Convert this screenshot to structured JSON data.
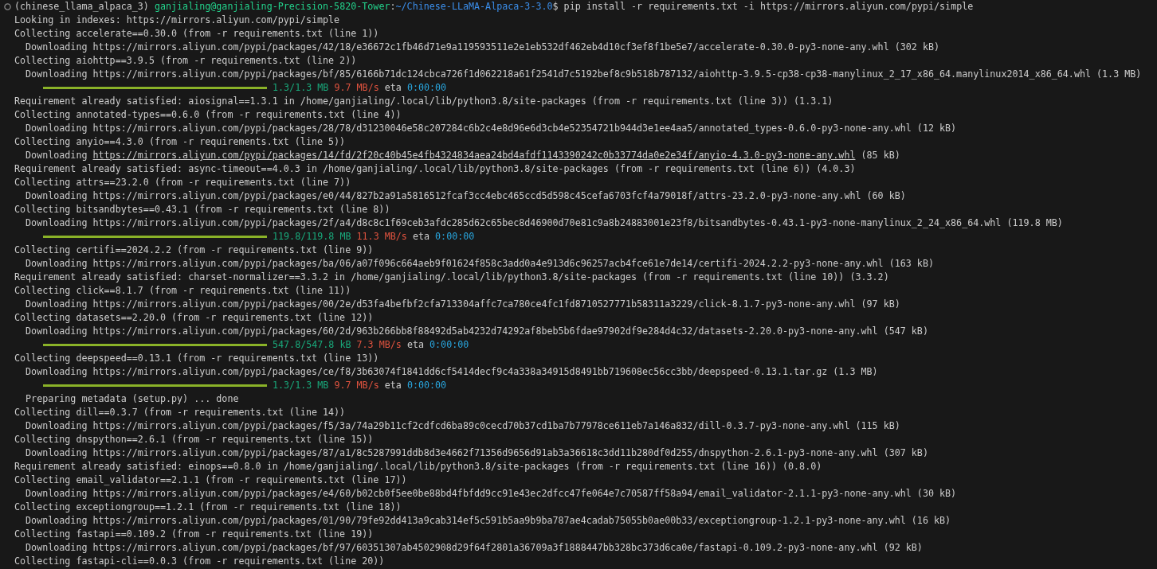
{
  "terminal": {
    "lines": [
      {
        "kind": "prompt",
        "env": "(chinese_llama_alpaca_3)",
        "user_host": "ganjialing@ganjialing-Precision-5820-Tower",
        "separator": ":",
        "path": "~/Chinese-LLaMA-Alpaca-3-3.0",
        "command": "$ pip install -r requirements.txt -i https://mirrors.aliyun.com/pypi/simple"
      },
      {
        "kind": "plain",
        "text": "Looking in indexes: https://mirrors.aliyun.com/pypi/simple"
      },
      {
        "kind": "plain",
        "text": "Collecting accelerate==0.30.0 (from -r requirements.txt (line 1))"
      },
      {
        "kind": "indented",
        "text": "Downloading https://mirrors.aliyun.com/pypi/packages/42/18/e36672c1fb46d71e9a119593511e2e1eb532df462eb4d10cf3ef8f1be5e7/accelerate-0.30.0-py3-none-any.whl (302 kB)"
      },
      {
        "kind": "plain",
        "text": "Collecting aiohttp==3.9.5 (from -r requirements.txt (line 2))"
      },
      {
        "kind": "indented",
        "text": "Downloading https://mirrors.aliyun.com/pypi/packages/bf/85/6166b71dc124cbca726f1d062218a61f2541d7c5192bef8c9b518b787132/aiohttp-3.9.5-cp38-cp38-manylinux_2_17_x86_64.manylinux2014_x86_64.whl (1.3 MB)"
      },
      {
        "kind": "progress",
        "level": 1,
        "size": "1.3/1.3 MB",
        "speed": "9.7 MB/s",
        "eta_label": "eta",
        "eta": "0:00:00"
      },
      {
        "kind": "plain",
        "text": "Requirement already satisfied: aiosignal==1.3.1 in /home/ganjialing/.local/lib/python3.8/site-packages (from -r requirements.txt (line 3)) (1.3.1)"
      },
      {
        "kind": "plain",
        "text": "Collecting annotated-types==0.6.0 (from -r requirements.txt (line 4))"
      },
      {
        "kind": "indented",
        "text": "Downloading https://mirrors.aliyun.com/pypi/packages/28/78/d31230046e58c207284c6b2c4e8d96e6d3cb4e52354721b944d3e1ee4aa5/annotated_types-0.6.0-py3-none-any.whl (12 kB)"
      },
      {
        "kind": "plain",
        "text": "Collecting anyio==4.3.0 (from -r requirements.txt (line 5))"
      },
      {
        "kind": "link",
        "prefix": "Downloading",
        "url": "https://mirrors.aliyun.com/pypi/packages/14/fd/2f20c40b45e4fb4324834aea24bd4afdf1143390242c0b33774da0e2e34f/anyio-4.3.0-py3-none-any.whl",
        "suffix": "(85 kB)"
      },
      {
        "kind": "plain",
        "text": "Requirement already satisfied: async-timeout==4.0.3 in /home/ganjialing/.local/lib/python3.8/site-packages (from -r requirements.txt (line 6)) (4.0.3)"
      },
      {
        "kind": "plain",
        "text": "Collecting attrs==23.2.0 (from -r requirements.txt (line 7))"
      },
      {
        "kind": "indented",
        "text": "Downloading https://mirrors.aliyun.com/pypi/packages/e0/44/827b2a91a5816512fcaf3cc4ebc465ccd5d598c45cefa6703fcf4a79018f/attrs-23.2.0-py3-none-any.whl (60 kB)"
      },
      {
        "kind": "plain",
        "text": "Collecting bitsandbytes==0.43.1 (from -r requirements.txt (line 8))"
      },
      {
        "kind": "indented",
        "text": "Downloading https://mirrors.aliyun.com/pypi/packages/2f/a4/d8c8c1f69ceb3afdc285d62c65bec8d46900d70e81c9a8b24883001e23f8/bitsandbytes-0.43.1-py3-none-manylinux_2_24_x86_64.whl (119.8 MB)"
      },
      {
        "kind": "progress",
        "level": 1,
        "size": "119.8/119.8 MB",
        "speed": "11.3 MB/s",
        "eta_label": "eta",
        "eta": "0:00:00"
      },
      {
        "kind": "plain",
        "text": "Collecting certifi==2024.2.2 (from -r requirements.txt (line 9))"
      },
      {
        "kind": "indented",
        "text": "Downloading https://mirrors.aliyun.com/pypi/packages/ba/06/a07f096c664aeb9f01624f858c3add0a4e913d6c96257acb4fce61e7de14/certifi-2024.2.2-py3-none-any.whl (163 kB)"
      },
      {
        "kind": "plain",
        "text": "Requirement already satisfied: charset-normalizer==3.3.2 in /home/ganjialing/.local/lib/python3.8/site-packages (from -r requirements.txt (line 10)) (3.3.2)"
      },
      {
        "kind": "plain",
        "text": "Collecting click==8.1.7 (from -r requirements.txt (line 11))"
      },
      {
        "kind": "indented",
        "text": "Downloading https://mirrors.aliyun.com/pypi/packages/00/2e/d53fa4befbf2cfa713304affc7ca780ce4fc1fd8710527771b58311a3229/click-8.1.7-py3-none-any.whl (97 kB)"
      },
      {
        "kind": "plain",
        "text": "Collecting datasets==2.20.0 (from -r requirements.txt (line 12))"
      },
      {
        "kind": "indented",
        "text": "Downloading https://mirrors.aliyun.com/pypi/packages/60/2d/963b266bb8f88492d5ab4232d74292af8beb5b6fdae97902df9e284d4c32/datasets-2.20.0-py3-none-any.whl (547 kB)"
      },
      {
        "kind": "progress",
        "level": 1,
        "size": "547.8/547.8 kB",
        "speed": "7.3 MB/s",
        "eta_label": "eta",
        "eta": "0:00:00"
      },
      {
        "kind": "plain",
        "text": "Collecting deepspeed==0.13.1 (from -r requirements.txt (line 13))"
      },
      {
        "kind": "indented",
        "text": "Downloading https://mirrors.aliyun.com/pypi/packages/ce/f8/3b63074f1841dd6cf5414decf9c4a338a34915d8491bb719608ec56cc3bb/deepspeed-0.13.1.tar.gz (1.3 MB)"
      },
      {
        "kind": "progress",
        "level": 1,
        "size": "1.3/1.3 MB",
        "speed": "9.7 MB/s",
        "eta_label": "eta",
        "eta": "0:00:00"
      },
      {
        "kind": "indented",
        "text": "Preparing metadata (setup.py) ... done"
      },
      {
        "kind": "plain",
        "text": "Collecting dill==0.3.7 (from -r requirements.txt (line 14))"
      },
      {
        "kind": "indented",
        "text": "Downloading https://mirrors.aliyun.com/pypi/packages/f5/3a/74a29b11cf2cdfcd6ba89c0cecd70b37cd1ba7b77978ce611eb7a146a832/dill-0.3.7-py3-none-any.whl (115 kB)"
      },
      {
        "kind": "plain",
        "text": "Collecting dnspython==2.6.1 (from -r requirements.txt (line 15))"
      },
      {
        "kind": "indented",
        "text": "Downloading https://mirrors.aliyun.com/pypi/packages/87/a1/8c5287991ddb8d3e4662f71356d9656d91ab3a36618c3dd11b280df0d255/dnspython-2.6.1-py3-none-any.whl (307 kB)"
      },
      {
        "kind": "plain",
        "text": "Requirement already satisfied: einops==0.8.0 in /home/ganjialing/.local/lib/python3.8/site-packages (from -r requirements.txt (line 16)) (0.8.0)"
      },
      {
        "kind": "plain",
        "text": "Collecting email_validator==2.1.1 (from -r requirements.txt (line 17))"
      },
      {
        "kind": "indented",
        "text": "Downloading https://mirrors.aliyun.com/pypi/packages/e4/60/b02cb0f5ee0be88bd4fbfdd9cc91e43ec2dfcc47fe064e7c70587ff58a94/email_validator-2.1.1-py3-none-any.whl (30 kB)"
      },
      {
        "kind": "plain",
        "text": "Collecting exceptiongroup==1.2.1 (from -r requirements.txt (line 18))"
      },
      {
        "kind": "indented",
        "text": "Downloading https://mirrors.aliyun.com/pypi/packages/01/90/79fe92dd413a9cab314ef5c591b5aa9b9ba787ae4cadab75055b0ae00b33/exceptiongroup-1.2.1-py3-none-any.whl (16 kB)"
      },
      {
        "kind": "plain",
        "text": "Collecting fastapi==0.109.2 (from -r requirements.txt (line 19))"
      },
      {
        "kind": "indented",
        "text": "Downloading https://mirrors.aliyun.com/pypi/packages/bf/97/60351307ab4502908d29f64f2801a36709a3f1888447bb328bc373d6ca0e/fastapi-0.109.2-py3-none-any.whl (92 kB)"
      },
      {
        "kind": "plain",
        "text": "Collecting fastapi-cli==0.0.3 (from -r requirements.txt (line 20))"
      }
    ]
  }
}
